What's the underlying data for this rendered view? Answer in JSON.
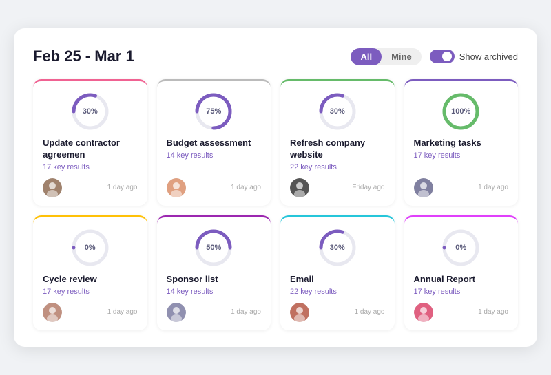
{
  "header": {
    "title": "Feb 25 - Mar 1",
    "filter": {
      "options": [
        "All",
        "Mine"
      ],
      "active": "All"
    },
    "toggle_label": "Show archived",
    "toggle_on": true
  },
  "cards": [
    {
      "id": "card-1",
      "title": "Update contractor agreemen",
      "key_results": "17 key results",
      "progress": 30,
      "time": "1 day ago",
      "border": "border-pink",
      "color": "#7c5cbf",
      "avatar_color": "#a0826d"
    },
    {
      "id": "card-2",
      "title": "Budget assessment",
      "key_results": "14 key results",
      "progress": 75,
      "time": "1 day ago",
      "border": "border-gray",
      "color": "#7c5cbf",
      "avatar_color": "#e0a080"
    },
    {
      "id": "card-3",
      "title": "Refresh company website",
      "key_results": "22 key results",
      "progress": 30,
      "time": "Friday ago",
      "border": "border-green",
      "color": "#7c5cbf",
      "avatar_color": "#555"
    },
    {
      "id": "card-4",
      "title": "Marketing tasks",
      "key_results": "17 key results",
      "progress": 100,
      "time": "1 day ago",
      "border": "border-purple",
      "color": "#66bb6a",
      "avatar_color": "#8080a0"
    },
    {
      "id": "card-5",
      "title": "Cycle review",
      "key_results": "17 key results",
      "progress": 0,
      "time": "1 day ago",
      "border": "border-yellow",
      "color": "#7c5cbf",
      "avatar_color": "#c09080"
    },
    {
      "id": "card-6",
      "title": "Sponsor list",
      "key_results": "14 key results",
      "progress": 50,
      "time": "1 day ago",
      "border": "border-violet",
      "color": "#7c5cbf",
      "avatar_color": "#9090b0"
    },
    {
      "id": "card-7",
      "title": "Email",
      "key_results": "22 key results",
      "progress": 30,
      "time": "1 day ago",
      "border": "border-cyan",
      "color": "#7c5cbf",
      "avatar_color": "#c07060"
    },
    {
      "id": "card-8",
      "title": "Annual Report",
      "key_results": "17 key results",
      "progress": 0,
      "time": "1 day ago",
      "border": "border-magenta",
      "color": "#7c5cbf",
      "avatar_color": "#e06080"
    }
  ]
}
